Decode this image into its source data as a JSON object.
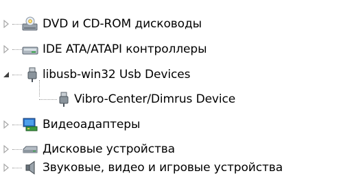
{
  "device_tree": {
    "items": [
      {
        "label": "DVD и CD-ROM дисководы",
        "icon": "dvd-drive-icon",
        "state": "collapsed"
      },
      {
        "label": "IDE ATA/ATAPI контроллеры",
        "icon": "ide-controller-icon",
        "state": "collapsed"
      },
      {
        "label": "libusb-win32 Usb Devices",
        "icon": "usb-plug-icon",
        "state": "expanded",
        "children": [
          {
            "label": "Vibro-Center/Dimrus Device",
            "icon": "usb-plug-icon"
          }
        ]
      },
      {
        "label": "Видеоадаптеры",
        "icon": "display-adapter-icon",
        "state": "collapsed"
      },
      {
        "label": "Дисковые устройства",
        "icon": "disk-drive-icon",
        "state": "collapsed"
      },
      {
        "label": "Звуковые, видео и игровые устройства",
        "icon": "speaker-icon",
        "state": "collapsed"
      }
    ]
  },
  "colors": {
    "expander_collapsed": "#a6a6a6",
    "expander_expanded": "#404040",
    "tree_lines": "#9a9a9a"
  }
}
